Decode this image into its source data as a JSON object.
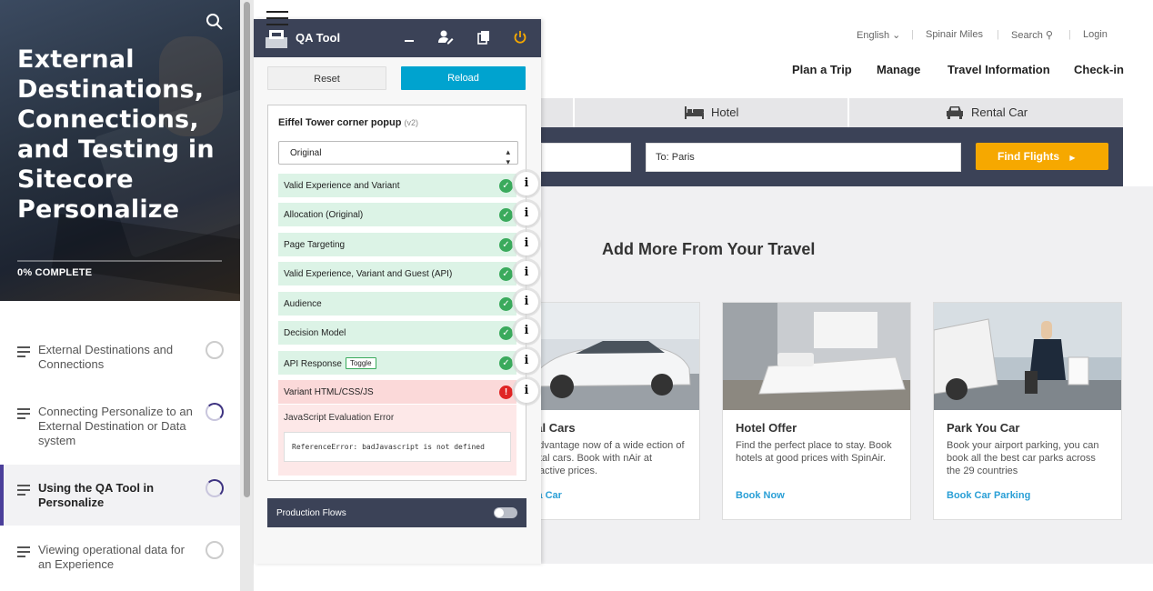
{
  "course": {
    "title": "External Destinations, Connections, and Testing in Sitecore Personalize",
    "progress_text": "0% COMPLETE",
    "lessons": [
      {
        "label": "External Destinations and Connections",
        "state": "not-started"
      },
      {
        "label": "Connecting Personalize to an External Destination or Data system",
        "state": "in-progress"
      },
      {
        "label": "Using the QA Tool in Personalize",
        "state": "in-progress",
        "active": true
      },
      {
        "label": "Viewing operational data for an Experience",
        "state": "not-started"
      }
    ]
  },
  "site": {
    "top_links": [
      "English",
      "Spinair Miles",
      "Search",
      "Login"
    ],
    "main_nav": [
      "Plan a Trip",
      "Manage",
      "Travel Information",
      "Check-in"
    ],
    "tabs": [
      "Hotel",
      "Rental Car"
    ],
    "to_field": "To: Paris",
    "find_button": "Find Flights",
    "section_title": "Add More From Your Travel",
    "cards": [
      {
        "title": "ntal Cars",
        "body": "e advantage now of a wide ection of rental cars. Book with nAir at attractive prices.",
        "link": "nt a Car"
      },
      {
        "title": "Hotel Offer",
        "body": "Find the perfect place to stay. Book hotels at good prices with SpinAir.",
        "link": "Book Now"
      },
      {
        "title": "Park You Car",
        "body": "Book your airport parking, you can book all the best car parks across the 29 countries",
        "link": "Book Car Parking"
      }
    ]
  },
  "qa": {
    "title": "QA Tool",
    "reset_label": "Reset",
    "reload_label": "Reload",
    "experience_name": "Eiffel Tower corner popup",
    "experience_version": "(v2)",
    "variant_selected": "Original",
    "checks": [
      {
        "label": "Valid Experience and Variant",
        "status": "pass"
      },
      {
        "label": "Allocation (Original)",
        "status": "pass"
      },
      {
        "label": "Page Targeting",
        "status": "pass"
      },
      {
        "label": "Valid Experience, Variant and Guest (API)",
        "status": "pass"
      },
      {
        "label": "Audience",
        "status": "pass"
      },
      {
        "label": "Decision Model",
        "status": "pass"
      },
      {
        "label": "API Response",
        "status": "pass",
        "toggle": "Toggle"
      },
      {
        "label": "Variant HTML/CSS/JS",
        "status": "error"
      }
    ],
    "error_title": "JavaScript Evaluation Error",
    "error_message": "ReferenceError: badJavascript is not defined",
    "production_flows_label": "Production Flows",
    "production_flows_on": false
  },
  "colors": {
    "header_navy": "#3b4257",
    "reload_blue": "#00a3cf",
    "pass_green": "#3aaa5c",
    "error_red": "#e02424",
    "find_orange": "#f6a800",
    "course_accent": "#4b3f9a"
  }
}
